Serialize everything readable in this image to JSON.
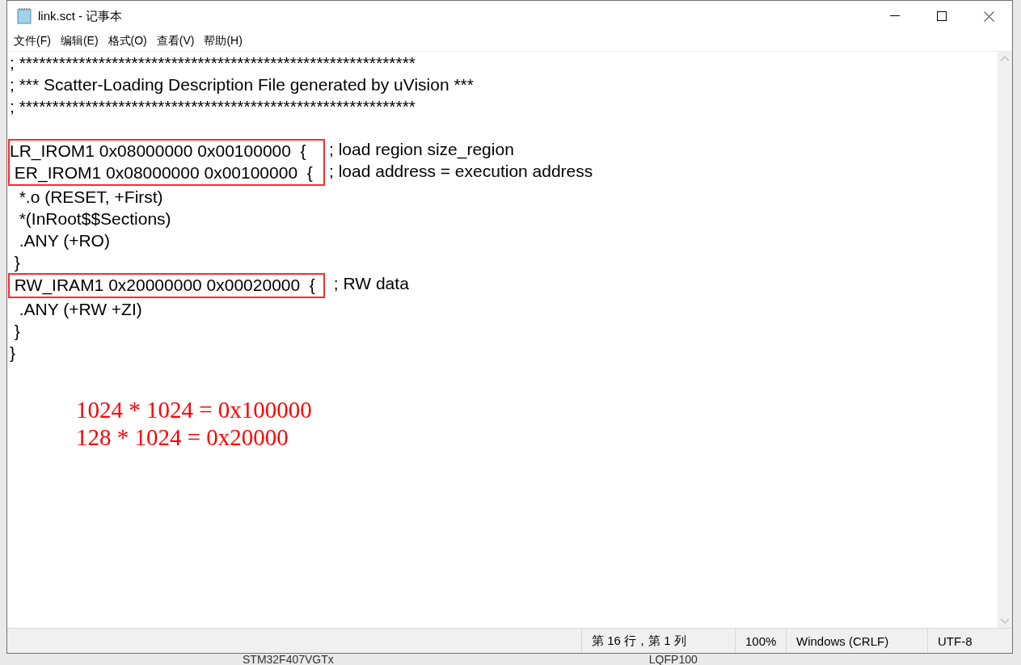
{
  "window": {
    "title": "link.sct - 记事本"
  },
  "menu": [
    "文件(F)",
    "编辑(E)",
    "格式(O)",
    "查看(V)",
    "帮助(H)"
  ],
  "editor": {
    "blocks": [
      {
        "kind": "plain",
        "lines": [
          "; ************************************************************",
          "; *** Scatter-Loading Description File generated by uVision ***",
          "; ************************************************************"
        ]
      },
      {
        "kind": "boxed",
        "lines": [
          {
            "code": "LR_IROM1 0x08000000 0x00100000  {",
            "comment": "; load region size_region"
          },
          {
            "code": " ER_IROM1 0x08000000 0x00100000  {",
            "comment": "; load address = execution address"
          }
        ]
      },
      {
        "kind": "plain",
        "lines": [
          "  *.o (RESET, +First)",
          "  *(InRoot$$Sections)",
          "  .ANY (+RO)",
          " }"
        ]
      },
      {
        "kind": "boxed",
        "lines": [
          {
            "code": " RW_IRAM1 0x20000000 0x00020000  {",
            "comment": " ; RW data"
          }
        ]
      },
      {
        "kind": "plain",
        "lines": [
          "  .ANY (+RW +ZI)",
          " }",
          "}"
        ]
      }
    ],
    "annotations": [
      "1024 * 1024 = 0x100000",
      "128 * 1024 = 0x20000"
    ]
  },
  "status_bar": [
    "第 16 行，第 1 列",
    "100%",
    "Windows (CRLF)",
    "UTF-8"
  ],
  "background": [
    "STM32F407VGTx",
    "LQFP100"
  ]
}
